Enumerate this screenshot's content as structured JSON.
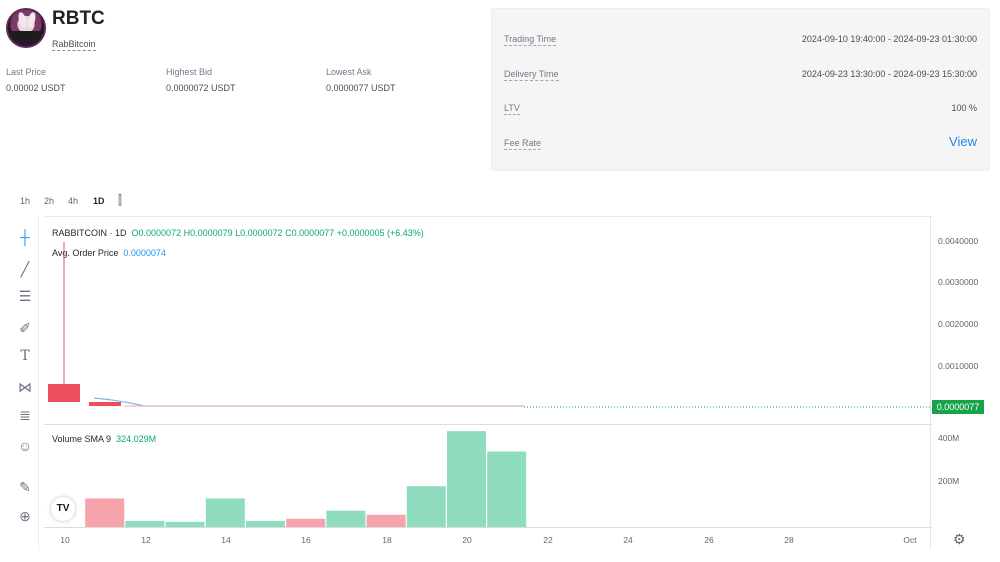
{
  "header": {
    "symbol": "RBTC",
    "name": "RabBitcoin",
    "stats": [
      {
        "label": "Last Price",
        "value": "0.00002 USDT"
      },
      {
        "label": "Highest Bid",
        "value": "0.0000072 USDT"
      },
      {
        "label": "Lowest Ask",
        "value": "0.0000077 USDT"
      }
    ]
  },
  "info": {
    "trading_time_label": "Trading Time",
    "trading_time_value": "2024-09-10 19:40:00 - 2024-09-23 01:30:00",
    "delivery_time_label": "Delivery Time",
    "delivery_time_value": "2024-09-23 13:30:00 - 2024-09-23 15:30:00",
    "ltv_label": "LTV",
    "ltv_value": "100 %",
    "fee_label": "Fee Rate",
    "fee_link": "View"
  },
  "intervals": [
    "1h",
    "2h",
    "4h",
    "1D"
  ],
  "active_interval": "1D",
  "chart": {
    "symbol_line": "RABBITCOIN · 1D",
    "ohlc": "O0.0000072 H0.0000079 L0.0000072 C0.0000077 +0.0000005 (+6.43%)",
    "avg_label": "Avg. Order Price",
    "avg_value": "0.0000074",
    "volume_label": "Volume SMA 9",
    "volume_value": "324.029M",
    "price_axis": [
      "0.0040000",
      "0.0030000",
      "0.0020000",
      "0.0010000"
    ],
    "last_price_tag": "0.0000077",
    "volume_axis": [
      "400M",
      "200M"
    ],
    "x_axis": [
      "10",
      "12",
      "14",
      "16",
      "18",
      "20",
      "22",
      "24",
      "26",
      "28",
      "Oct"
    ],
    "colors": {
      "up": "#8fdcbf",
      "down": "#f6a3ab",
      "down_candle": "#ee4d5e",
      "accent": "#2196f3",
      "green": "#16a34a"
    }
  },
  "chart_data": {
    "type": "bar",
    "categories": [
      "10",
      "11",
      "12",
      "13",
      "14",
      "15",
      "16",
      "17",
      "18",
      "19",
      "20",
      "21"
    ],
    "series": [
      {
        "values": [
          0,
          140,
          30,
          25,
          140,
          30,
          40,
          80,
          60,
          200,
          470,
          370
        ]
      }
    ],
    "direction": [
      "down",
      "down",
      "up",
      "up",
      "up",
      "up",
      "down",
      "up",
      "down",
      "up",
      "up",
      "up"
    ],
    "ylabel": "",
    "ylim": [
      0,
      500
    ]
  }
}
